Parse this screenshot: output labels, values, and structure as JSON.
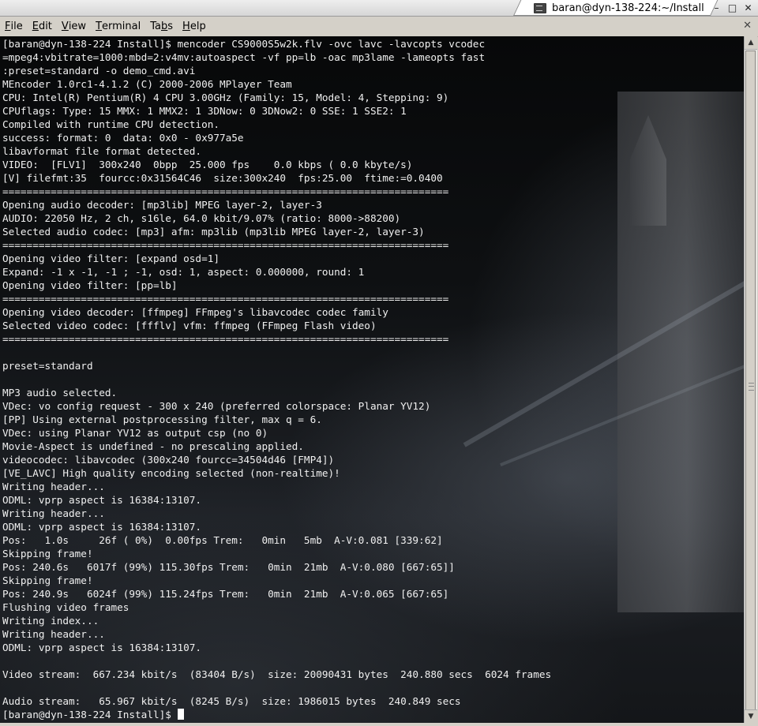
{
  "window": {
    "title": "baran@dyn-138-224:~/Install",
    "minimize_glyph": "–",
    "maximize_glyph": "□",
    "close_glyph": "✕"
  },
  "menubar": {
    "items": [
      {
        "key": "F",
        "rest": "ile"
      },
      {
        "key": "E",
        "rest": "dit"
      },
      {
        "key": "V",
        "rest": "iew"
      },
      {
        "key": "T",
        "rest": "erminal"
      },
      {
        "pre": "Ta",
        "key": "b",
        "rest": "s"
      },
      {
        "key": "H",
        "rest": "elp"
      }
    ],
    "close_glyph": "✕"
  },
  "terminal": {
    "lines": [
      "[baran@dyn-138-224 Install]$ mencoder CS9000S5w2k.flv -ovc lavc -lavcopts vcodec",
      "=mpeg4:vbitrate=1000:mbd=2:v4mv:autoaspect -vf pp=lb -oac mp3lame -lameopts fast",
      ":preset=standard -o demo_cmd.avi",
      "MEncoder 1.0rc1-4.1.2 (C) 2000-2006 MPlayer Team",
      "CPU: Intel(R) Pentium(R) 4 CPU 3.00GHz (Family: 15, Model: 4, Stepping: 9)",
      "CPUflags: Type: 15 MMX: 1 MMX2: 1 3DNow: 0 3DNow2: 0 SSE: 1 SSE2: 1",
      "Compiled with runtime CPU detection.",
      "success: format: 0  data: 0x0 - 0x977a5e",
      "libavformat file format detected.",
      "VIDEO:  [FLV1]  300x240  0bpp  25.000 fps    0.0 kbps ( 0.0 kbyte/s)",
      "[V] filefmt:35  fourcc:0x31564C46  size:300x240  fps:25.00  ftime:=0.0400",
      "==========================================================================",
      "Opening audio decoder: [mp3lib] MPEG layer-2, layer-3",
      "AUDIO: 22050 Hz, 2 ch, s16le, 64.0 kbit/9.07% (ratio: 8000->88200)",
      "Selected audio codec: [mp3] afm: mp3lib (mp3lib MPEG layer-2, layer-3)",
      "==========================================================================",
      "Opening video filter: [expand osd=1]",
      "Expand: -1 x -1, -1 ; -1, osd: 1, aspect: 0.000000, round: 1",
      "Opening video filter: [pp=lb]",
      "==========================================================================",
      "Opening video decoder: [ffmpeg] FFmpeg's libavcodec codec family",
      "Selected video codec: [ffflv] vfm: ffmpeg (FFmpeg Flash video)",
      "==========================================================================",
      "",
      "preset=standard",
      "",
      "MP3 audio selected.",
      "VDec: vo config request - 300 x 240 (preferred colorspace: Planar YV12)",
      "[PP] Using external postprocessing filter, max q = 6.",
      "VDec: using Planar YV12 as output csp (no 0)",
      "Movie-Aspect is undefined - no prescaling applied.",
      "videocodec: libavcodec (300x240 fourcc=34504d46 [FMP4])",
      "[VE_LAVC] High quality encoding selected (non-realtime)!",
      "Writing header...",
      "ODML: vprp aspect is 16384:13107.",
      "Writing header...",
      "ODML: vprp aspect is 16384:13107.",
      "Pos:   1.0s     26f ( 0%)  0.00fps Trem:   0min   5mb  A-V:0.081 [339:62]",
      "Skipping frame!",
      "Pos: 240.6s   6017f (99%) 115.30fps Trem:   0min  21mb  A-V:0.080 [667:65]]",
      "Skipping frame!",
      "Pos: 240.9s   6024f (99%) 115.24fps Trem:   0min  21mb  A-V:0.065 [667:65]",
      "Flushing video frames",
      "Writing index...",
      "Writing header...",
      "ODML: vprp aspect is 16384:13107.",
      "",
      "Video stream:  667.234 kbit/s  (83404 B/s)  size: 20090431 bytes  240.880 secs  6024 frames",
      "",
      "Audio stream:   65.967 kbit/s  (8245 B/s)  size: 1986015 bytes  240.849 secs"
    ],
    "prompt": "[baran@dyn-138-224 Install]$ "
  },
  "scrollbar": {
    "up_glyph": "▲",
    "down_glyph": "▼"
  }
}
